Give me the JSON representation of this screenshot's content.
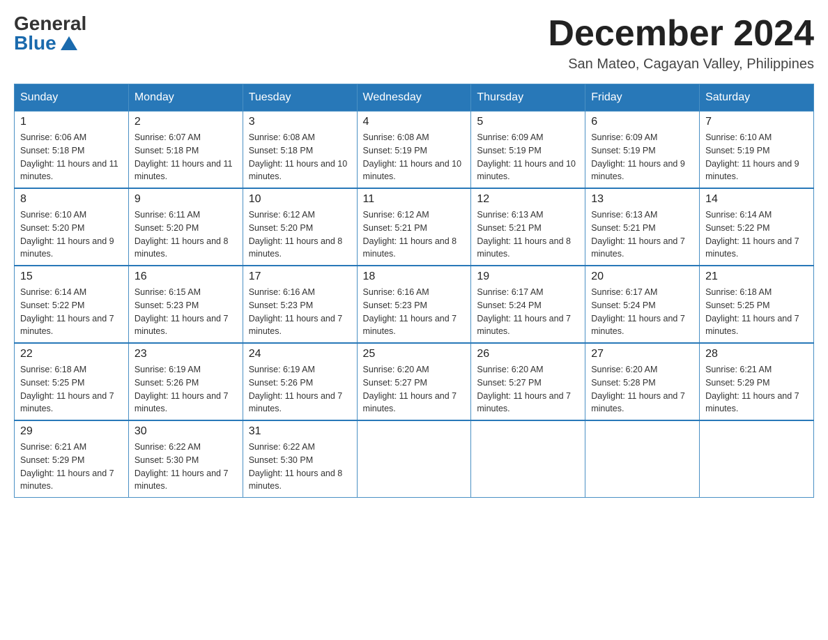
{
  "logo": {
    "general": "General",
    "blue": "Blue"
  },
  "title": "December 2024",
  "subtitle": "San Mateo, Cagayan Valley, Philippines",
  "weekdays": [
    "Sunday",
    "Monday",
    "Tuesday",
    "Wednesday",
    "Thursday",
    "Friday",
    "Saturday"
  ],
  "weeks": [
    [
      {
        "day": "1",
        "sunrise": "6:06 AM",
        "sunset": "5:18 PM",
        "daylight": "11 hours and 11 minutes."
      },
      {
        "day": "2",
        "sunrise": "6:07 AM",
        "sunset": "5:18 PM",
        "daylight": "11 hours and 11 minutes."
      },
      {
        "day": "3",
        "sunrise": "6:08 AM",
        "sunset": "5:18 PM",
        "daylight": "11 hours and 10 minutes."
      },
      {
        "day": "4",
        "sunrise": "6:08 AM",
        "sunset": "5:19 PM",
        "daylight": "11 hours and 10 minutes."
      },
      {
        "day": "5",
        "sunrise": "6:09 AM",
        "sunset": "5:19 PM",
        "daylight": "11 hours and 10 minutes."
      },
      {
        "day": "6",
        "sunrise": "6:09 AM",
        "sunset": "5:19 PM",
        "daylight": "11 hours and 9 minutes."
      },
      {
        "day": "7",
        "sunrise": "6:10 AM",
        "sunset": "5:19 PM",
        "daylight": "11 hours and 9 minutes."
      }
    ],
    [
      {
        "day": "8",
        "sunrise": "6:10 AM",
        "sunset": "5:20 PM",
        "daylight": "11 hours and 9 minutes."
      },
      {
        "day": "9",
        "sunrise": "6:11 AM",
        "sunset": "5:20 PM",
        "daylight": "11 hours and 8 minutes."
      },
      {
        "day": "10",
        "sunrise": "6:12 AM",
        "sunset": "5:20 PM",
        "daylight": "11 hours and 8 minutes."
      },
      {
        "day": "11",
        "sunrise": "6:12 AM",
        "sunset": "5:21 PM",
        "daylight": "11 hours and 8 minutes."
      },
      {
        "day": "12",
        "sunrise": "6:13 AM",
        "sunset": "5:21 PM",
        "daylight": "11 hours and 8 minutes."
      },
      {
        "day": "13",
        "sunrise": "6:13 AM",
        "sunset": "5:21 PM",
        "daylight": "11 hours and 7 minutes."
      },
      {
        "day": "14",
        "sunrise": "6:14 AM",
        "sunset": "5:22 PM",
        "daylight": "11 hours and 7 minutes."
      }
    ],
    [
      {
        "day": "15",
        "sunrise": "6:14 AM",
        "sunset": "5:22 PM",
        "daylight": "11 hours and 7 minutes."
      },
      {
        "day": "16",
        "sunrise": "6:15 AM",
        "sunset": "5:23 PM",
        "daylight": "11 hours and 7 minutes."
      },
      {
        "day": "17",
        "sunrise": "6:16 AM",
        "sunset": "5:23 PM",
        "daylight": "11 hours and 7 minutes."
      },
      {
        "day": "18",
        "sunrise": "6:16 AM",
        "sunset": "5:23 PM",
        "daylight": "11 hours and 7 minutes."
      },
      {
        "day": "19",
        "sunrise": "6:17 AM",
        "sunset": "5:24 PM",
        "daylight": "11 hours and 7 minutes."
      },
      {
        "day": "20",
        "sunrise": "6:17 AM",
        "sunset": "5:24 PM",
        "daylight": "11 hours and 7 minutes."
      },
      {
        "day": "21",
        "sunrise": "6:18 AM",
        "sunset": "5:25 PM",
        "daylight": "11 hours and 7 minutes."
      }
    ],
    [
      {
        "day": "22",
        "sunrise": "6:18 AM",
        "sunset": "5:25 PM",
        "daylight": "11 hours and 7 minutes."
      },
      {
        "day": "23",
        "sunrise": "6:19 AM",
        "sunset": "5:26 PM",
        "daylight": "11 hours and 7 minutes."
      },
      {
        "day": "24",
        "sunrise": "6:19 AM",
        "sunset": "5:26 PM",
        "daylight": "11 hours and 7 minutes."
      },
      {
        "day": "25",
        "sunrise": "6:20 AM",
        "sunset": "5:27 PM",
        "daylight": "11 hours and 7 minutes."
      },
      {
        "day": "26",
        "sunrise": "6:20 AM",
        "sunset": "5:27 PM",
        "daylight": "11 hours and 7 minutes."
      },
      {
        "day": "27",
        "sunrise": "6:20 AM",
        "sunset": "5:28 PM",
        "daylight": "11 hours and 7 minutes."
      },
      {
        "day": "28",
        "sunrise": "6:21 AM",
        "sunset": "5:29 PM",
        "daylight": "11 hours and 7 minutes."
      }
    ],
    [
      {
        "day": "29",
        "sunrise": "6:21 AM",
        "sunset": "5:29 PM",
        "daylight": "11 hours and 7 minutes."
      },
      {
        "day": "30",
        "sunrise": "6:22 AM",
        "sunset": "5:30 PM",
        "daylight": "11 hours and 7 minutes."
      },
      {
        "day": "31",
        "sunrise": "6:22 AM",
        "sunset": "5:30 PM",
        "daylight": "11 hours and 8 minutes."
      },
      null,
      null,
      null,
      null
    ]
  ]
}
